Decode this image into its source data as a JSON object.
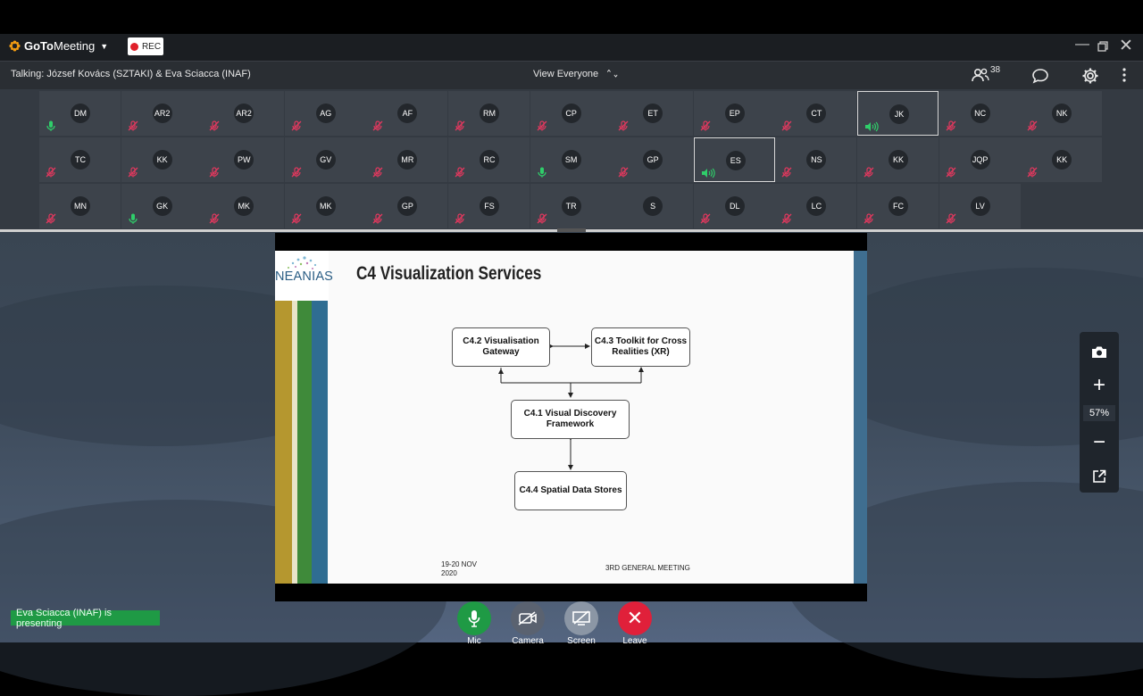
{
  "app": {
    "name_part1": "GoTo",
    "name_part2": "Meeting",
    "rec_label": "REC"
  },
  "infobar": {
    "talking": "Talking: József Kovács (SZTAKI) & Eva Sciacca (INAF)",
    "view": "View Everyone",
    "participant_count": "38"
  },
  "participants": [
    {
      "initials": "DM",
      "mic": "on"
    },
    {
      "initials": "AR2",
      "mic": "muted"
    },
    {
      "initials": "AR2",
      "mic": "muted"
    },
    {
      "initials": "AG",
      "mic": "muted"
    },
    {
      "initials": "AF",
      "mic": "muted"
    },
    {
      "initials": "RM",
      "mic": "muted"
    },
    {
      "initials": "CP",
      "mic": "muted"
    },
    {
      "initials": "ET",
      "mic": "muted"
    },
    {
      "initials": "EP",
      "mic": "muted"
    },
    {
      "initials": "CT",
      "mic": "muted"
    },
    {
      "initials": "JK",
      "mic": "speaking"
    },
    {
      "initials": "NC",
      "mic": "muted"
    },
    {
      "initials": "NK",
      "mic": "muted"
    },
    {
      "initials": "TC",
      "mic": "muted"
    },
    {
      "initials": "KK",
      "mic": "muted"
    },
    {
      "initials": "PW",
      "mic": "muted"
    },
    {
      "initials": "GV",
      "mic": "muted"
    },
    {
      "initials": "MR",
      "mic": "muted"
    },
    {
      "initials": "RC",
      "mic": "muted"
    },
    {
      "initials": "SM",
      "mic": "on"
    },
    {
      "initials": "GP",
      "mic": "muted"
    },
    {
      "initials": "ES",
      "mic": "speaking"
    },
    {
      "initials": "NS",
      "mic": "muted"
    },
    {
      "initials": "KK",
      "mic": "muted"
    },
    {
      "initials": "JQP",
      "mic": "muted"
    },
    {
      "initials": "KK",
      "mic": "muted"
    },
    {
      "initials": "MN",
      "mic": "muted"
    },
    {
      "initials": "GK",
      "mic": "on"
    },
    {
      "initials": "MK",
      "mic": "muted"
    },
    {
      "initials": "MK",
      "mic": "muted"
    },
    {
      "initials": "GP",
      "mic": "muted"
    },
    {
      "initials": "FS",
      "mic": "muted"
    },
    {
      "initials": "TR",
      "mic": "muted"
    },
    {
      "initials": "S",
      "mic": "none"
    },
    {
      "initials": "DL",
      "mic": "muted"
    },
    {
      "initials": "LC",
      "mic": "muted"
    },
    {
      "initials": "FC",
      "mic": "muted"
    },
    {
      "initials": "LV",
      "mic": "muted"
    }
  ],
  "slide": {
    "logo_text": "NEANIAS",
    "title": "C4 Visualization Services",
    "box_gateway": "C4.2 Visualisation Gateway",
    "box_xr": "C4.3 Toolkit for Cross Realities (XR)",
    "box_framework": "C4.1 Visual Discovery Framework",
    "box_stores": "C4.4 Spatial Data Stores",
    "footer_date": "19-20 NOV\n2020",
    "footer_meeting": "3RD GENERAL MEETING"
  },
  "zoom": {
    "level": "57%"
  },
  "presenting": "Eva Sciacca (INAF) is presenting",
  "controls": {
    "mic": "Mic",
    "camera": "Camera",
    "screen": "Screen",
    "leave": "Leave"
  },
  "colors": {
    "accent_green": "#1f9a45",
    "muted_red": "#e2385e",
    "leave_red": "#e0203a",
    "stripe_gold": "#b5972f",
    "stripe_green": "#3f8a3a",
    "stripe_blue": "#2f6d92"
  }
}
